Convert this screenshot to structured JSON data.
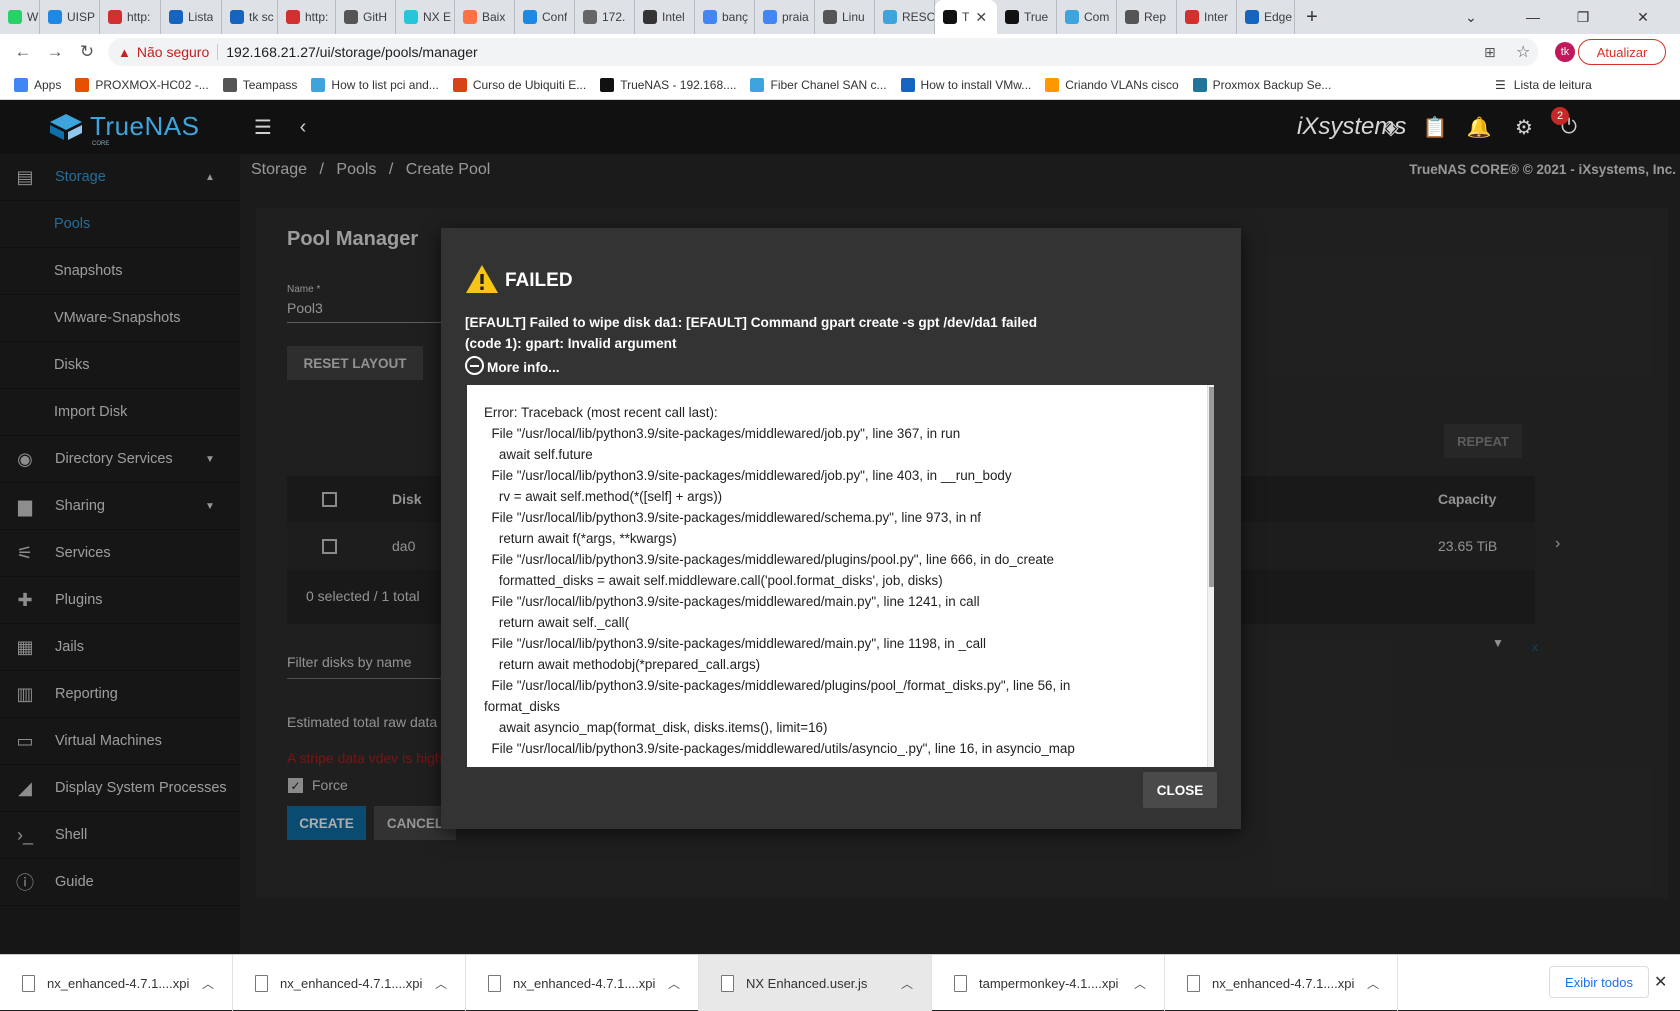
{
  "browser": {
    "tabs": [
      {
        "title": "Wha",
        "color": "#25d366"
      },
      {
        "title": "UISP",
        "color": "#1e88e5"
      },
      {
        "title": "http:",
        "color": "#d32f2f"
      },
      {
        "title": "Lista",
        "color": "#1565c0"
      },
      {
        "title": "tk sc",
        "color": "#1565c0"
      },
      {
        "title": "http:",
        "color": "#d32f2f"
      },
      {
        "title": "GitH",
        "color": "#555555"
      },
      {
        "title": "NX E",
        "color": "#26c6da"
      },
      {
        "title": "Baix",
        "color": "#ff7043"
      },
      {
        "title": "Conf",
        "color": "#1e88e5"
      },
      {
        "title": "172.",
        "color": "#666666"
      },
      {
        "title": "Intel",
        "color": "#333333"
      },
      {
        "title": "banç",
        "color": "#4285f4"
      },
      {
        "title": "praia",
        "color": "#4285f4"
      },
      {
        "title": "Linu",
        "color": "#555555"
      },
      {
        "title": "RESC",
        "color": "#3ea4dd"
      },
      {
        "title": "T",
        "color": "#111111",
        "active": true
      },
      {
        "title": "True",
        "color": "#111111"
      },
      {
        "title": "Com",
        "color": "#3ea4dd"
      },
      {
        "title": "Rep",
        "color": "#555555"
      },
      {
        "title": "Inter",
        "color": "#d32f2f"
      },
      {
        "title": "Edge",
        "color": "#1565c0"
      }
    ],
    "new_tab": "+",
    "security_label": "Não seguro",
    "url": "192.168.21.27/ui/storage/pools/manager",
    "update_button": "Atualizar",
    "avatar_initials": "tk",
    "bookmarks": [
      {
        "label": "Apps",
        "color": "#4285f4"
      },
      {
        "label": "PROXMOX-HC02 -...",
        "color": "#e65100"
      },
      {
        "label": "Teampass",
        "color": "#555555"
      },
      {
        "label": "How to list pci and...",
        "color": "#3ea4dd"
      },
      {
        "label": "Curso de Ubiquiti E...",
        "color": "#d84315"
      },
      {
        "label": "TrueNAS - 192.168....",
        "color": "#111111"
      },
      {
        "label": "Fiber Chanel SAN c...",
        "color": "#3ea4dd"
      },
      {
        "label": "How to install VMw...",
        "color": "#1565c0"
      },
      {
        "label": "Criando VLANs cisco",
        "color": "#ff9800"
      },
      {
        "label": "Proxmox Backup Se...",
        "color": "#21759b"
      }
    ],
    "reading_list": "Lista de leitura"
  },
  "app": {
    "logo_text": "TrueNAS",
    "logo_sub": "CORE",
    "vendor": "iXsystems",
    "notification_count": "2",
    "breadcrumb": {
      "a": "Storage",
      "b": "Pools",
      "c": "Create Pool"
    },
    "copyright": "TrueNAS CORE® © 2021 - iXsystems, Inc."
  },
  "sidebar": {
    "items": [
      {
        "label": "Storage",
        "icon": "storage-icon",
        "active": true,
        "expand": true
      },
      {
        "label": "Pools",
        "sub": true,
        "active": true
      },
      {
        "label": "Snapshots",
        "sub": true
      },
      {
        "label": "VMware-Snapshots",
        "sub": true
      },
      {
        "label": "Disks",
        "sub": true
      },
      {
        "label": "Import Disk",
        "sub": true
      },
      {
        "label": "Directory Services",
        "icon": "directory-icon",
        "expand": true
      },
      {
        "label": "Sharing",
        "icon": "sharing-icon",
        "expand": true
      },
      {
        "label": "Services",
        "icon": "services-icon"
      },
      {
        "label": "Plugins",
        "icon": "plugins-icon"
      },
      {
        "label": "Jails",
        "icon": "jails-icon"
      },
      {
        "label": "Reporting",
        "icon": "reporting-icon"
      },
      {
        "label": "Virtual Machines",
        "icon": "vm-icon"
      },
      {
        "label": "Display System Processes",
        "icon": "processes-icon"
      },
      {
        "label": "Shell",
        "icon": "shell-icon"
      },
      {
        "label": "Guide",
        "icon": "guide-icon"
      }
    ]
  },
  "pool_manager": {
    "title": "Pool Manager",
    "name_label": "Name *",
    "name_value": "Pool3",
    "reset_layout": "RESET LAYOUT",
    "repeat": "REPEAT",
    "col_disk": "Disk",
    "col_capacity": "Capacity",
    "row_disk": "da0",
    "row_capacity": "23.65 TiB",
    "selected_summary": "0 selected / 1 total",
    "filter_label": "Filter disks by name",
    "estimated_label": "Estimated total raw data",
    "warning_text": "A stripe data vdev is high",
    "force_label": "Force",
    "create": "CREATE",
    "cancel": "CANCEL"
  },
  "dialog": {
    "title": "FAILED",
    "message_line1": "[EFAULT] Failed to wipe disk da1: [EFAULT] Command gpart create -s gpt /dev/da1 failed",
    "message_line2": "(code 1): gpart: Invalid argument",
    "more_info": "More info...",
    "traceback": "Error: Traceback (most recent call last):\n  File \"/usr/local/lib/python3.9/site-packages/middlewared/job.py\", line 367, in run\n    await self.future\n  File \"/usr/local/lib/python3.9/site-packages/middlewared/job.py\", line 403, in __run_body\n    rv = await self.method(*([self] + args))\n  File \"/usr/local/lib/python3.9/site-packages/middlewared/schema.py\", line 973, in nf\n    return await f(*args, **kwargs)\n  File \"/usr/local/lib/python3.9/site-packages/middlewared/plugins/pool.py\", line 666, in do_create\n    formatted_disks = await self.middleware.call('pool.format_disks', job, disks)\n  File \"/usr/local/lib/python3.9/site-packages/middlewared/main.py\", line 1241, in call\n    return await self._call(\n  File \"/usr/local/lib/python3.9/site-packages/middlewared/main.py\", line 1198, in _call\n    return await methodobj(*prepared_call.args)\n  File \"/usr/local/lib/python3.9/site-packages/middlewared/plugins/pool_/format_disks.py\", line 56, in\nformat_disks\n    await asyncio_map(format_disk, disks.items(), limit=16)\n  File \"/usr/local/lib/python3.9/site-packages/middlewared/utils/asyncio_.py\", line 16, in asyncio_map",
    "close": "CLOSE"
  },
  "downloads": {
    "items": [
      "nx_enhanced-4.7.1....xpi",
      "nx_enhanced-4.7.1....xpi",
      "nx_enhanced-4.7.1....xpi",
      "NX Enhanced.user.js",
      "tampermonkey-4.1....xpi",
      "nx_enhanced-4.7.1....xpi"
    ],
    "show_all": "Exibir todos"
  },
  "colors": {
    "accent": "#3a9fe0",
    "create_button": "#0f6fa8",
    "warning": "#f5c518",
    "error_text": "#b71c1c"
  }
}
